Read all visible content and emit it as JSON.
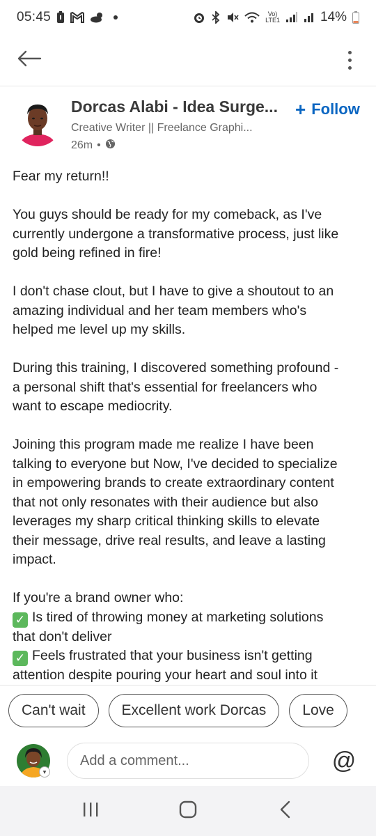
{
  "status_bar": {
    "time": "05:45",
    "battery": "14%",
    "network_label": "LTE1"
  },
  "post": {
    "author": {
      "name": "Dorcas Alabi - Idea Surge...",
      "headline": "Creative Writer || Freelance Graphi...",
      "time": "26m"
    },
    "follow_label": "Follow",
    "paragraphs": [
      [
        "Fear my return!!"
      ],
      [
        "You guys should be ready for my comeback, as I've",
        "currently undergone a transformative process, just like",
        "gold being refined in fire!"
      ],
      [
        "I don't chase clout, but I have to give a shoutout to an",
        "amazing individual and her team members who's",
        "helped me level up my skills."
      ],
      [
        "During this training, I discovered something profound -",
        "a personal shift that's essential for freelancers who",
        "want to escape mediocrity."
      ],
      [
        "Joining this program made me realize I have been",
        "talking to everyone but Now, I've decided to specialize",
        "in empowering brands to create extraordinary content",
        "that not only resonates with their audience but also",
        "leverages my sharp critical thinking skills to elevate",
        "their message, drive real results, and leave a lasting",
        "impact."
      ]
    ],
    "list_intro": "If you're a brand owner who:",
    "checklist": [
      [
        "Is tired of throwing money at marketing solutions",
        "that don't deliver"
      ],
      [
        "Feels frustrated that your business isn't getting",
        "attention despite pouring your heart and soul into it"
      ]
    ],
    "check_glyph": "✓"
  },
  "quick_replies": [
    "Can't wait",
    "Excellent work Dorcas",
    "Love"
  ],
  "comment": {
    "placeholder": "Add a comment...",
    "mention_symbol": "@"
  },
  "colors": {
    "accent": "#0a66c2",
    "check_green": "#5cb85c"
  },
  "icons": {
    "back": "back-arrow-icon",
    "more": "more-vertical-icon",
    "globe": "globe-icon",
    "recents": "recents-icon",
    "home": "home-icon",
    "system_back": "system-back-icon"
  }
}
